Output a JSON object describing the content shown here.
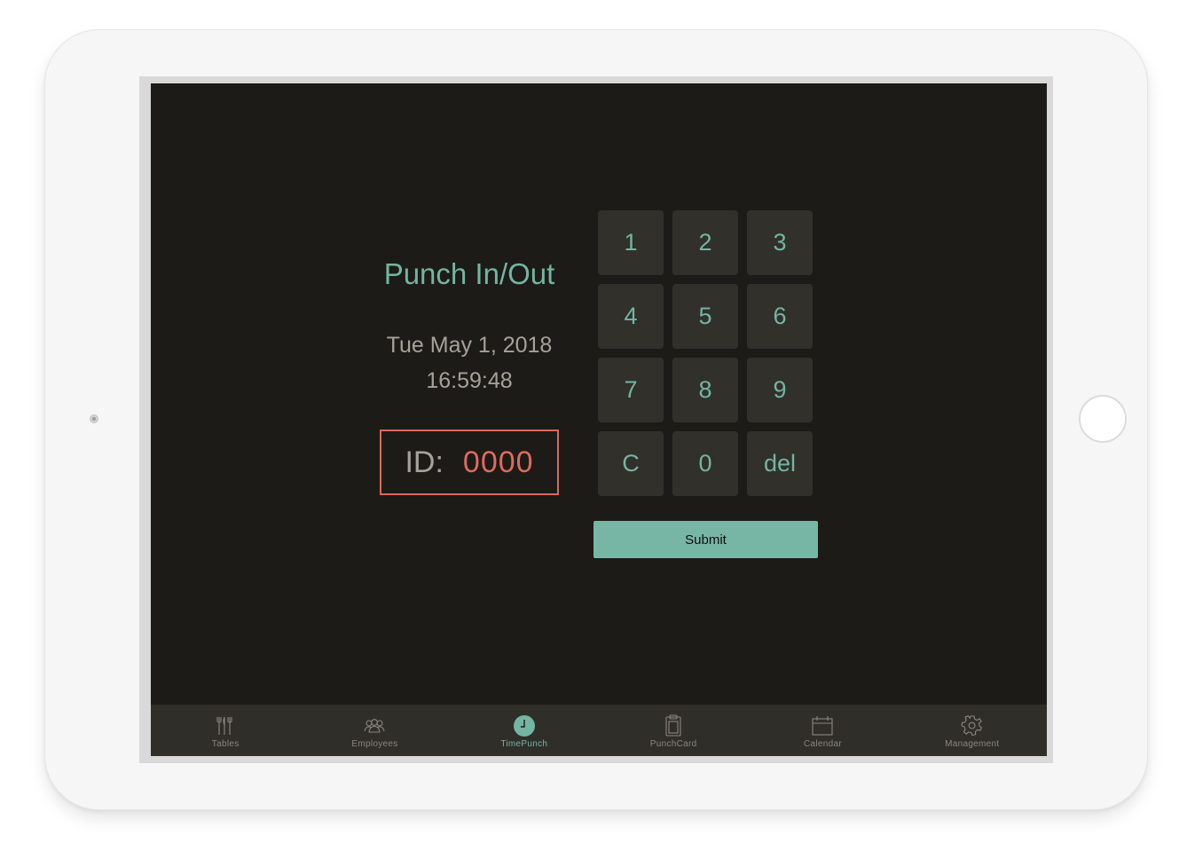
{
  "app": {
    "title": "Punch In/Out",
    "date": "Tue May 1, 2018",
    "time": "16:59:48"
  },
  "id_field": {
    "label": "ID:",
    "value": "0000"
  },
  "keypad": {
    "keys": [
      "1",
      "2",
      "3",
      "4",
      "5",
      "6",
      "7",
      "8",
      "9",
      "C",
      "0",
      "del"
    ]
  },
  "submit_label": "Submit",
  "tabbar": {
    "active": "TimePunch",
    "tabs": [
      {
        "label": "Tables",
        "icon": "utensils-icon"
      },
      {
        "label": "Employees",
        "icon": "people-icon"
      },
      {
        "label": "TimePunch",
        "icon": "clock-icon"
      },
      {
        "label": "PunchCard",
        "icon": "clipboard-icon"
      },
      {
        "label": "Calendar",
        "icon": "calendar-icon"
      },
      {
        "label": "Management",
        "icon": "gear-icon"
      }
    ]
  },
  "colors": {
    "accent": "#74b4a2",
    "id_value": "#e0695e",
    "id_border": "#d9685d",
    "background": "#1c1b17",
    "key_bg": "#31302b",
    "tabbar_bg": "#302e29",
    "muted_text": "#a6a19a"
  }
}
